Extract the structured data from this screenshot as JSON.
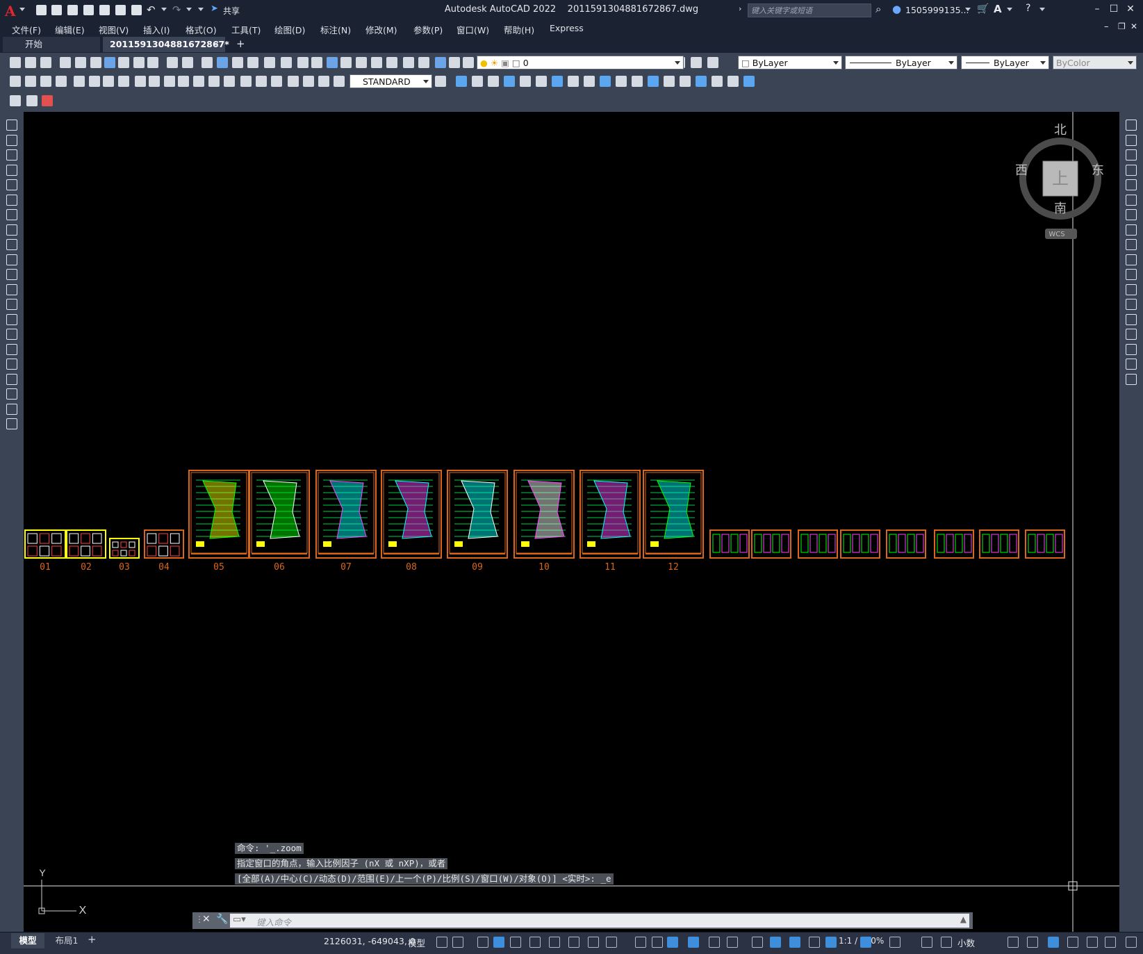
{
  "titlebar": {
    "app_title": "Autodesk AutoCAD 2022",
    "file_name": "2011591304881672867.dwg",
    "share_label": "共享",
    "search_placeholder": "键入关键字或短语",
    "user_name": "1505999135..."
  },
  "menu": [
    "文件(F)",
    "编辑(E)",
    "视图(V)",
    "插入(I)",
    "格式(O)",
    "工具(T)",
    "绘图(D)",
    "标注(N)",
    "修改(M)",
    "参数(P)",
    "窗口(W)",
    "帮助(H)",
    "Express"
  ],
  "tabs": {
    "start_label": "开始",
    "doc_label": "2011591304881672867*"
  },
  "properties": {
    "layer_value": "0",
    "color_value": "ByLayer",
    "linetype_value": "ByLayer",
    "lineweight_value": "ByLayer",
    "plotstyle_value": "ByColor",
    "text_style_value": "STANDARD"
  },
  "viewcube": {
    "north": "北",
    "south": "南",
    "east": "东",
    "west": "西",
    "top_face": "上",
    "wcs_label": "WCS"
  },
  "ucs": {
    "x_label": "X",
    "y_label": "Y"
  },
  "drawing": {
    "sheet_labels": [
      "01",
      "02",
      "03",
      "04",
      "05",
      "06",
      "07",
      "08",
      "09",
      "10",
      "11",
      "12"
    ],
    "frame_color": "#d9661a",
    "highlight_color": "#ffff00"
  },
  "command": {
    "history": [
      "命令: '_.zoom",
      "指定窗口的角点，输入比例因子 (nX 或 nXP)，或者",
      "[全部(A)/中心(C)/动态(D)/范围(E)/上一个(P)/比例(S)/窗口(W)/对象(O)] <实时>: _e"
    ],
    "input_placeholder": "键入命令"
  },
  "status": {
    "layout_tabs": [
      "模型",
      "布局1"
    ],
    "coordinates": "2126031, -649043, 0",
    "model_label": "模型",
    "scale_label": "1:1 / 100%",
    "units_label": "小数"
  }
}
